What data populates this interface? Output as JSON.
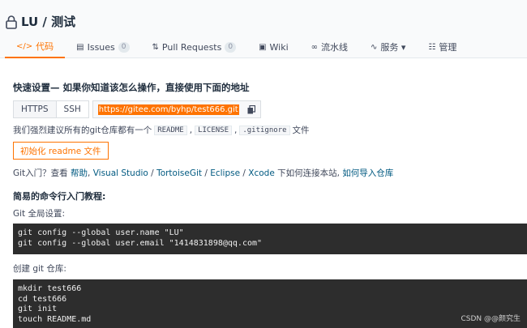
{
  "header": {
    "repo_name": "LU / 测试"
  },
  "tabs": [
    {
      "icon": "code-icon",
      "label": "代码",
      "active": true
    },
    {
      "icon": "issues-icon",
      "label": "Issues",
      "count": "0"
    },
    {
      "icon": "pull-request-icon",
      "label": "Pull Requests",
      "count": "0"
    },
    {
      "icon": "wiki-icon",
      "label": "Wiki"
    },
    {
      "icon": "pipeline-icon",
      "label": "流水线"
    },
    {
      "icon": "service-icon",
      "label": "服务 ▾"
    },
    {
      "icon": "manage-icon",
      "label": "管理"
    }
  ],
  "quick_setup": {
    "title": "快速设置— 如果你知道该怎么操作，直接使用下面的地址",
    "https_label": "HTTPS",
    "ssh_label": "SSH",
    "url": "https://gitee.com/byhp/test666.git",
    "suggest_prefix": "我们强烈建议所有的git仓库都有一个",
    "files": [
      "README",
      "LICENSE",
      ".gitignore"
    ],
    "sep": ",",
    "suggest_suffix": "文件",
    "init_button": "初始化 readme 文件"
  },
  "help": {
    "prefix": "Git入门？查看 ",
    "link_help": "帮助",
    "sep1": ", ",
    "link_vs": "Visual Studio",
    "sep2": " / ",
    "link_tortoise": "TortoiseGit",
    "sep3": " / ",
    "link_eclipse": "Eclipse",
    "sep4": " / ",
    "link_xcode": "Xcode",
    "middle": " 下如何连接本站, ",
    "link_import": "如何导入仓库"
  },
  "tutorial": {
    "title": "简易的命令行入门教程:",
    "global_label": "Git 全局设置:",
    "global_lines": [
      "git config --global user.name \"LU\"",
      "git config --global user.email \"1414831898@qq.com\""
    ],
    "create_label": "创建 git 仓库:",
    "create_lines": [
      "mkdir test666",
      "cd test666",
      "git init",
      "touch README.md"
    ]
  },
  "watermark": "CSDN @@颜究生"
}
